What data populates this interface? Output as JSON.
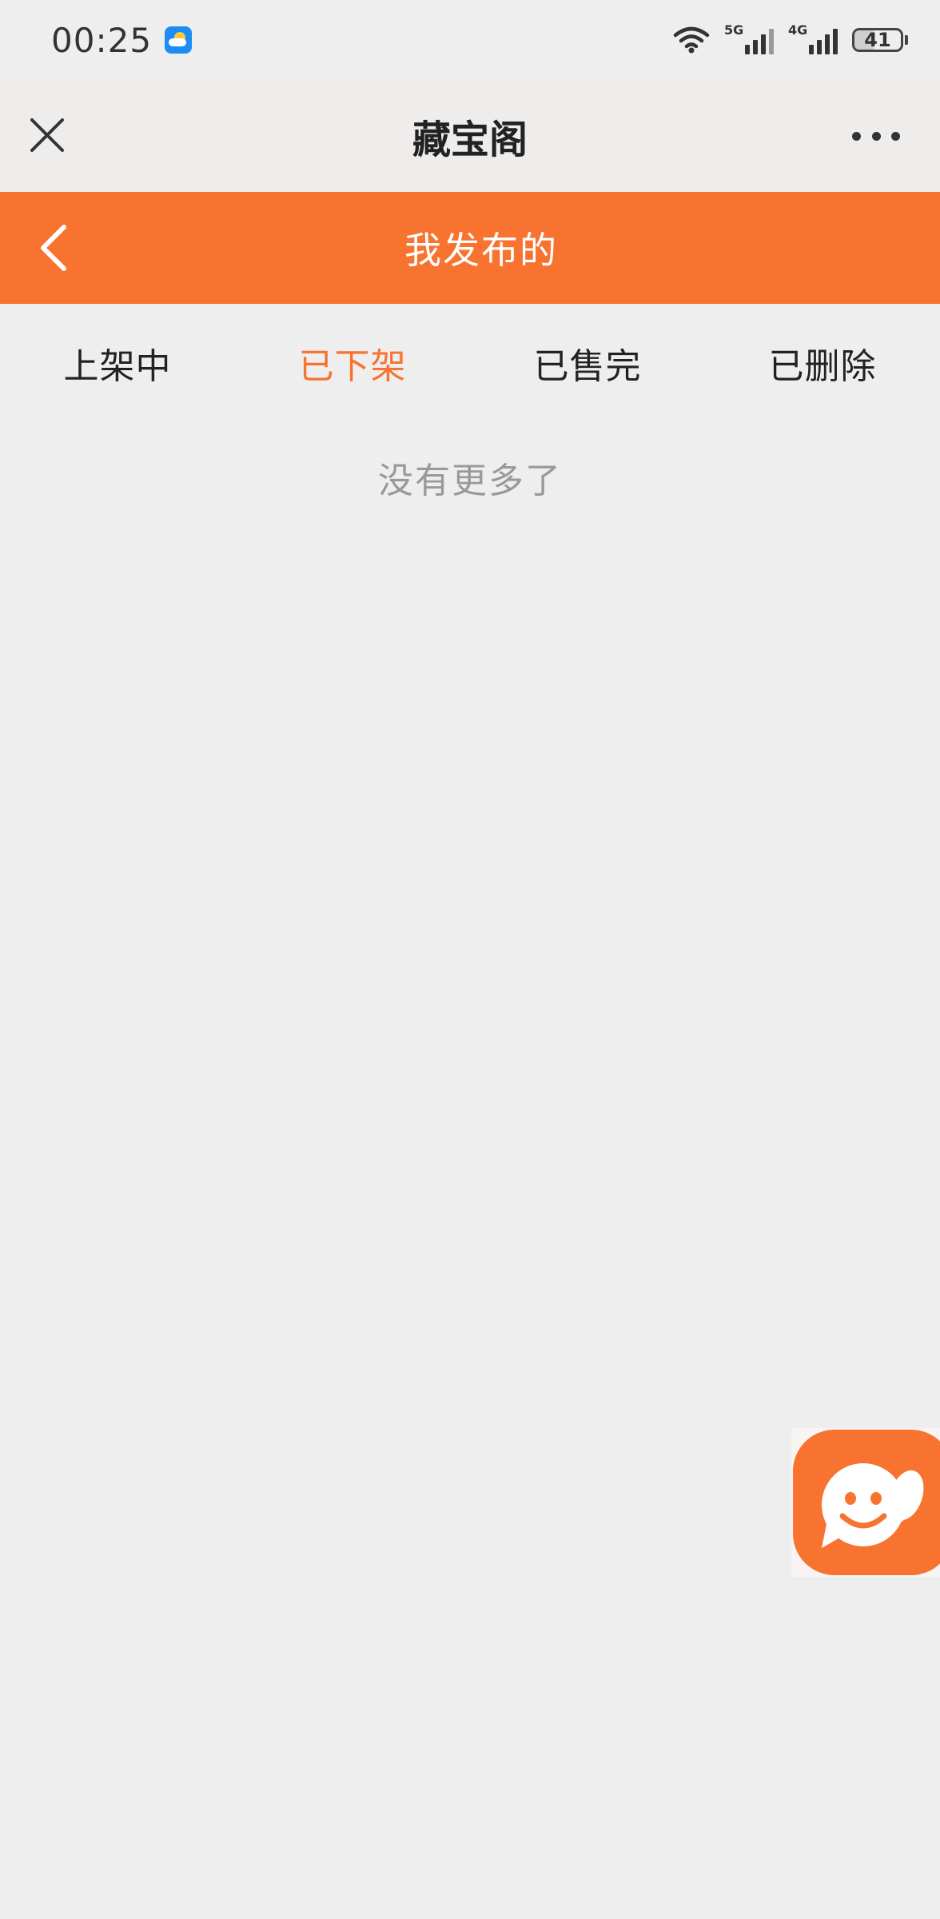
{
  "status_bar": {
    "time": "00:25",
    "network_1": "5G",
    "network_2": "4G",
    "battery_level": "41",
    "battery_percent": 41,
    "icons": [
      "weather-icon",
      "wifi-icon",
      "signal-5g-icon",
      "signal-4g-icon",
      "battery-icon"
    ]
  },
  "title_bar": {
    "title": "藏宝阁",
    "close_icon": "close-icon",
    "more_icon": "more-icon"
  },
  "header": {
    "title": "我发布的",
    "back_icon": "back-chevron-icon",
    "color": "#f7732f"
  },
  "tabs": [
    {
      "label": "上架中",
      "active": false
    },
    {
      "label": "已下架",
      "active": true
    },
    {
      "label": "已售完",
      "active": false
    },
    {
      "label": "已删除",
      "active": false
    }
  ],
  "list": {
    "empty_message": "没有更多了"
  },
  "chat_button": {
    "icon": "chat-smile-icon",
    "color": "#f7732f"
  }
}
